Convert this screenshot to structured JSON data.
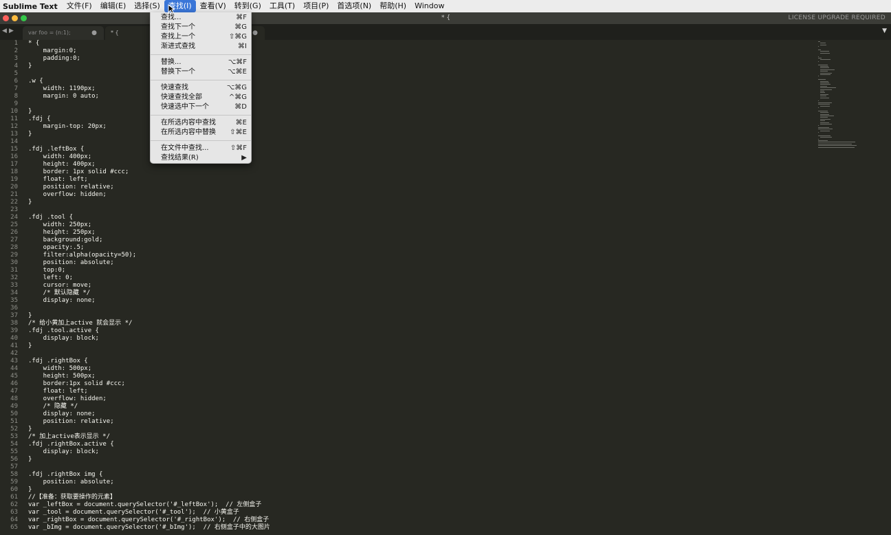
{
  "menubar": {
    "app_name": "Sublime Text",
    "items": [
      {
        "label": "文件(F)"
      },
      {
        "label": "编辑(E)"
      },
      {
        "label": "选择(S)"
      },
      {
        "label": "查找(I)"
      },
      {
        "label": "查看(V)"
      },
      {
        "label": "转到(G)"
      },
      {
        "label": "工具(T)"
      },
      {
        "label": "项目(P)"
      },
      {
        "label": "首选项(N)"
      },
      {
        "label": "帮助(H)"
      },
      {
        "label": "Window"
      }
    ],
    "active_index": 3
  },
  "window": {
    "title": "* {",
    "license_text": "LICENSE UPGRADE REQUIRED",
    "traffic_colors": [
      "#fc605c",
      "#fdbc40",
      "#34c84a"
    ]
  },
  "tabs": [
    {
      "label": "var foo = (n:1);",
      "active": false
    },
    {
      "label": "* {",
      "active": true
    }
  ],
  "find_menu": {
    "groups": [
      [
        {
          "label": "查找...",
          "shortcut": "⌘F"
        },
        {
          "label": "查找下一个",
          "shortcut": "⌘G"
        },
        {
          "label": "查找上一个",
          "shortcut": "⇧⌘G"
        },
        {
          "label": "渐进式查找",
          "shortcut": "⌘I"
        }
      ],
      [
        {
          "label": "替换...",
          "shortcut": "⌥⌘F"
        },
        {
          "label": "替换下一个",
          "shortcut": "⌥⌘E"
        }
      ],
      [
        {
          "label": "快速查找",
          "shortcut": "⌥⌘G"
        },
        {
          "label": "快速查找全部",
          "shortcut": "^⌘G"
        },
        {
          "label": "快速选中下一个",
          "shortcut": "⌘D"
        }
      ],
      [
        {
          "label": "在所选内容中查找",
          "shortcut": "⌘E"
        },
        {
          "label": "在所选内容中替换",
          "shortcut": "⇧⌘E"
        }
      ],
      [
        {
          "label": "在文件中查找...",
          "shortcut": "⇧⌘F"
        },
        {
          "label": "查找结果(R)",
          "shortcut": "▶"
        }
      ]
    ]
  },
  "editor": {
    "lines": [
      "* {",
      "    margin:0;",
      "    padding:0;",
      "}",
      "",
      ".w {",
      "    width: 1190px;",
      "    margin: 0 auto;",
      "",
      "}",
      ".fdj {",
      "    margin-top: 20px;",
      "}",
      "",
      ".fdj .leftBox {",
      "    width: 400px;",
      "    height: 400px;",
      "    border: 1px solid #ccc;",
      "    float: left;",
      "    position: relative;",
      "    overflow: hidden;",
      "}",
      "",
      ".fdj .tool {",
      "    width: 250px;",
      "    height: 250px;",
      "    background:gold;",
      "    opacity:.5;",
      "    filter:alpha(opacity=50);",
      "    position: absolute;",
      "    top:0;",
      "    left: 0;",
      "    cursor: move;",
      "    /* 默认隐藏 */",
      "    display: none;",
      "",
      "}",
      "/* 给小黄加上active 就会显示 */",
      ".fdj .tool.active {",
      "    display: block;",
      "}",
      "",
      ".fdj .rightBox {",
      "    width: 500px;",
      "    height: 500px;",
      "    border:1px solid #ccc;",
      "    float: left;",
      "    overflow: hidden;",
      "    /* 隐藏 */",
      "    display: none;",
      "    position: relative;",
      "}",
      "/* 加上active表示显示 */",
      ".fdj .rightBox.active {",
      "    display: block;",
      "}",
      "",
      ".fdj .rightBox img {",
      "    position: absolute;",
      "}",
      "//【准备：获取要操作的元素】",
      "var _leftBox = document.querySelector('#_leftBox');  // 左侧盒子",
      "var _tool = document.querySelector('#_tool');  // 小黄盒子",
      "var _rightBox = document.querySelector('#_rightBox');  // 右侧盒子",
      "var _bImg = document.querySelector('#_bImg');  // 右侧盒子中的大图片"
    ]
  }
}
